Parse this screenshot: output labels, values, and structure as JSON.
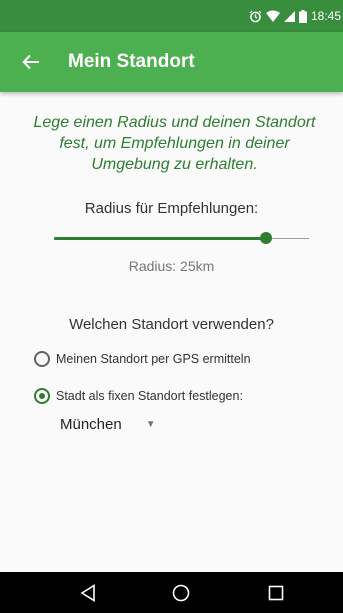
{
  "status_bar": {
    "time": "18:45",
    "icons": [
      "alarm-icon",
      "wifi-icon",
      "signal-icon",
      "battery-icon"
    ]
  },
  "app_bar": {
    "title": "Mein Standort",
    "back_icon": "arrow-back-icon",
    "color": "#4caf50"
  },
  "intro_text": "Lege einen Radius und deinen Standort fest, um Empfehlungen in deiner Umgebung zu erhalten.",
  "radius": {
    "label": "Radius für Empfehlungen:",
    "value_text": "Radius: 25km",
    "slider_fraction": 0.83
  },
  "location": {
    "question": "Welchen Standort verwenden?",
    "options": [
      {
        "label": "Meinen Standort per GPS ermitteln",
        "selected": false
      },
      {
        "label": "Stadt als fixen Standort festlegen:",
        "selected": true
      }
    ],
    "city": "München"
  },
  "colors": {
    "accent": "#2e7d32",
    "status_bar": "#388e3c"
  },
  "nav_bar": {
    "icons": [
      "back-triangle-icon",
      "home-circle-icon",
      "recents-square-icon"
    ]
  }
}
